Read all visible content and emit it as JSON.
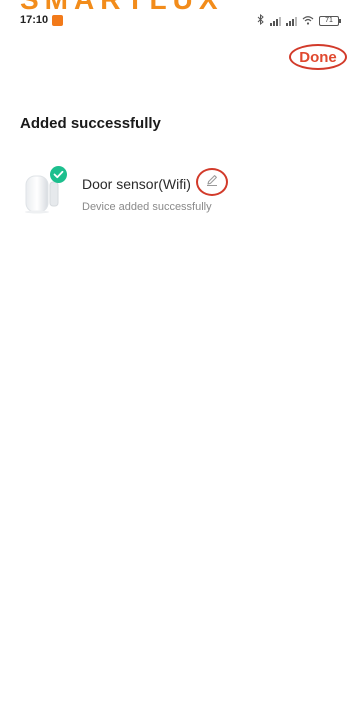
{
  "banner": {
    "text": "SMARTLUX"
  },
  "status_bar": {
    "time": "17:10",
    "bluetooth_icon": "bluetooth-icon",
    "wifi_icon": "wifi-icon",
    "battery_level": "71"
  },
  "header": {
    "done_label": "Done"
  },
  "main": {
    "title": "Added successfully",
    "devices": [
      {
        "name": "Door sensor(Wifi)",
        "status": "Device added successfully",
        "icon": "door-sensor-icon",
        "badge_icon": "check-icon",
        "edit_icon": "pencil-icon"
      }
    ]
  },
  "colors": {
    "accent_green": "#1dbf8e",
    "highlight_red": "#d23a2a",
    "done_text": "#e0492f",
    "banner_orange": "#f28c1b"
  }
}
